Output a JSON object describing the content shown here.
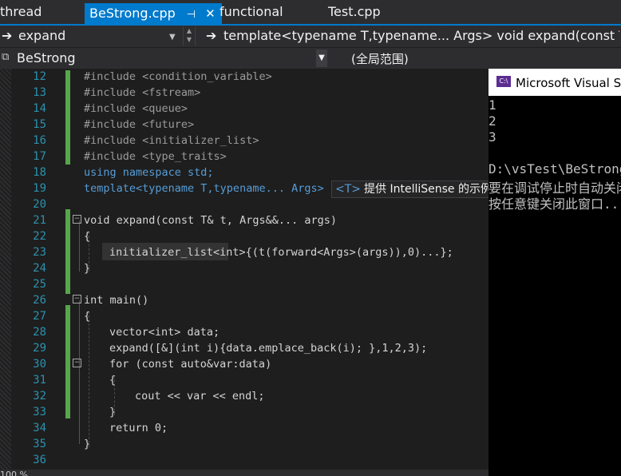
{
  "tabs": [
    {
      "label": "thread",
      "active": false
    },
    {
      "label": "BeStrong.cpp",
      "active": true,
      "pin": "⊣",
      "close": "✕"
    },
    {
      "label": "functional",
      "active": false
    },
    {
      "label": "Test.cpp",
      "active": false
    }
  ],
  "nav": {
    "member_arrow": "➔",
    "member": "expand",
    "signature_arrow": "➔",
    "signature": "template<typename T,typename... Args> void expand(const T& t, Ar",
    "project": "BeStrong",
    "scope": "(全局范围)"
  },
  "editor": {
    "line_numbers": [
      "12",
      "13",
      "14",
      "15",
      "16",
      "17",
      "18",
      "19",
      "20",
      "21",
      "22",
      "23",
      "24",
      "25",
      "26",
      "27",
      "28",
      "29",
      "30",
      "31",
      "32",
      "33",
      "34",
      "35",
      "36"
    ],
    "quick_info": {
      "tag": "<T>",
      "text": "提供 IntelliSense 的示例"
    },
    "code": {
      "l12": "#include <condition_variable>",
      "l13": "#include <fstream>",
      "l14": "#include <queue>",
      "l15": "#include <future>",
      "l16": "#include <initializer_list>",
      "l17": "#include <type_traits>",
      "l18": "using namespace std;",
      "l19": "template<typename T,typename... Args>",
      "l21": "void expand(const T& t, Args&&... args)",
      "l22": "{",
      "l23": "initializer_list<int>{(t(forward<Args>(args)),0)...};",
      "l24": "}",
      "l26": "int main()",
      "l27": "{",
      "l28": "vector<int> data;",
      "l29": "expand([&](int i){data.emplace_back(i); },1,2,3);",
      "l30": "for (const auto&var:data)",
      "l31": "{",
      "l32": "cout << var << endl;",
      "l33": "}",
      "l34": "return 0;",
      "l35": "}"
    },
    "status_zoom": "100 %"
  },
  "console": {
    "title": "Microsoft Visual Studio 调试控制台",
    "lines": [
      "1",
      "2",
      "3",
      "",
      "D:\\vsTest\\BeStrong\\Debug\\BeStrong.exe",
      "要在调试停止时自动关闭控制台",
      "按任意键关闭此窗口..."
    ]
  },
  "colors": {
    "accent": "#007acc",
    "keyword": "#569cd6",
    "type": "#4ec9b0",
    "function": "#ff8000",
    "string": "#d69d85",
    "change_bar": "#57a64a"
  }
}
